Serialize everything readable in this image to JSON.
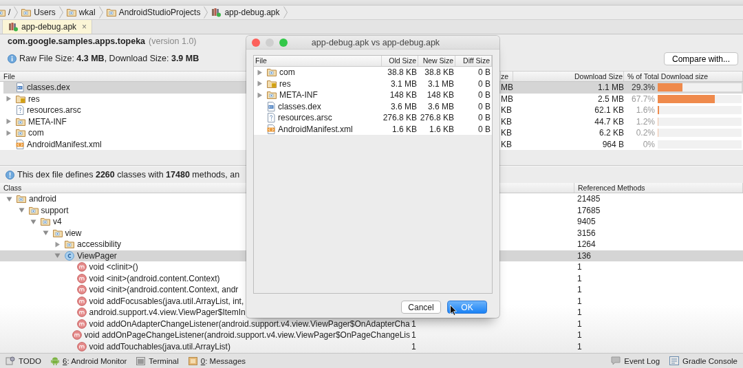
{
  "breadcrumb": [
    {
      "label": "/",
      "kind": "folder"
    },
    {
      "label": "Users",
      "kind": "folder"
    },
    {
      "label": "wkal",
      "kind": "folder"
    },
    {
      "label": "AndroidStudioProjects",
      "kind": "folder"
    },
    {
      "label": "app-debug.apk",
      "kind": "apk"
    }
  ],
  "tabs": [
    {
      "label": "app-debug.apk",
      "close": "×",
      "selected": true
    }
  ],
  "summary": {
    "package": "com.google.samples.apps.topeka",
    "version": "(version 1.0)",
    "sizes": "Raw File Size: **4.3 MB**, Download Size: **3.9 MB**",
    "compare_button": "Compare with..."
  },
  "file_table": {
    "columns": [
      "File",
      "ze",
      "Download Size",
      "% of Total Download size"
    ],
    "rows": [
      {
        "name": "classes.dex",
        "kind": "dex",
        "column_2": "MB",
        "download_size": "1.1 MB",
        "percent": "29.3%",
        "level": 0.293,
        "selected": true
      },
      {
        "name": "res",
        "kind": "res",
        "expanded": false,
        "column_2": "MB",
        "download_size": "2.5 MB",
        "percent": "67.7%",
        "level": 0.677,
        "selected": false
      },
      {
        "name": "resources.arsc",
        "kind": "arsc",
        "column_2": "KB",
        "download_size": "62.1 KB",
        "percent": "1.6%",
        "level": 0.016,
        "selected": false
      },
      {
        "name": "META-INF",
        "kind": "folder",
        "expanded": false,
        "column_2": "KB",
        "download_size": "44.7 KB",
        "percent": "1.2%",
        "level": 0.012,
        "selected": false
      },
      {
        "name": "com",
        "kind": "folder",
        "expanded": false,
        "column_2": "KB",
        "download_size": "6.2 KB",
        "percent": "0.2%",
        "level": 0.002,
        "selected": false
      },
      {
        "name": "AndroidManifest.xml",
        "kind": "xml",
        "column_2": "KB",
        "download_size": "964 B",
        "percent": "0%",
        "level": 0,
        "selected": false
      }
    ]
  },
  "dex_info": "This dex file defines **2260** classes with **17480** methods, an",
  "class_tree": {
    "columns": [
      "Class",
      "Referenced Methods"
    ],
    "nodes": [
      {
        "name": "android",
        "kind": "package",
        "refs": "21485",
        "expanded": true,
        "selected": false,
        "children": [
          {
            "name": "support",
            "kind": "package",
            "refs": "17685",
            "expanded": true,
            "selected": false,
            "children": [
              {
                "name": "v4",
                "kind": "package",
                "refs": "9405",
                "expanded": true,
                "selected": false,
                "children": [
                  {
                    "name": "view",
                    "kind": "package",
                    "refs": "3156",
                    "expanded": true,
                    "selected": false,
                    "children": [
                      {
                        "name": "accessibility",
                        "kind": "package",
                        "refs": "1264",
                        "expanded": false,
                        "selected": false
                      },
                      {
                        "name": "ViewPager",
                        "kind": "class",
                        "refs": "136",
                        "expanded": true,
                        "selected": true,
                        "children": [
                          {
                            "name": "void <clinit>()",
                            "kind": "method",
                            "refs": "1",
                            "selected": false
                          },
                          {
                            "name": "void <init>(android.content.Context)",
                            "kind": "method",
                            "refs": "1",
                            "selected": false
                          },
                          {
                            "name": "void <init>(android.content.Context, andr",
                            "kind": "method",
                            "refs": "1",
                            "selected": false
                          },
                          {
                            "name": "void addFocusables(java.util.ArrayList, int,",
                            "kind": "method",
                            "refs": "1",
                            "selected": false
                          },
                          {
                            "name": "android.support.v4.view.ViewPager$ItemIn",
                            "kind": "method",
                            "refs": "1",
                            "selected": false
                          },
                          {
                            "name": "void addOnAdapterChangeListener(android.support.v4.view.ViewPager$OnAdapterCha",
                            "kind": "method",
                            "column_2": "1",
                            "refs": "1",
                            "selected": false
                          },
                          {
                            "name": "void addOnPageChangeListener(android.support.v4.view.ViewPager$OnPageChangeLis",
                            "kind": "method",
                            "column_2": "1",
                            "refs": "1",
                            "selected": false
                          },
                          {
                            "name": "void addTouchables(java.util.ArrayList)",
                            "kind": "method",
                            "column_2": "1",
                            "refs": "1",
                            "selected": false
                          }
                        ]
                      }
                    ]
                  }
                ]
              }
            ]
          }
        ]
      }
    ]
  },
  "dialog": {
    "title": "app-debug.apk vs app-debug.apk",
    "columns": [
      "File",
      "Old Size",
      "New Size",
      "Diff Size"
    ],
    "rows": [
      {
        "name": "com",
        "kind": "folder",
        "expanded": false,
        "old_size": "38.8 KB",
        "new_size": "38.8 KB",
        "diff_size": "0 B"
      },
      {
        "name": "res",
        "kind": "res",
        "expanded": false,
        "old_size": "3.1 MB",
        "new_size": "3.1 MB",
        "diff_size": "0 B"
      },
      {
        "name": "META-INF",
        "kind": "folder",
        "expanded": false,
        "old_size": "148 KB",
        "new_size": "148 KB",
        "diff_size": "0 B"
      },
      {
        "name": "classes.dex",
        "kind": "dex",
        "old_size": "3.6 MB",
        "new_size": "3.6 MB",
        "diff_size": "0 B"
      },
      {
        "name": "resources.arsc",
        "kind": "arsc",
        "old_size": "276.8 KB",
        "new_size": "276.8 KB",
        "diff_size": "0 B"
      },
      {
        "name": "AndroidManifest.xml",
        "kind": "xml",
        "old_size": "1.6 KB",
        "new_size": "1.6 KB",
        "diff_size": "0 B"
      }
    ],
    "buttons": [
      {
        "label": "Cancel",
        "default": false
      },
      {
        "label": "OK",
        "default": true
      }
    ]
  },
  "status_bar": {
    "left": [
      {
        "kind": "todo",
        "label": "TODO"
      },
      {
        "kind": "android",
        "mnemonic": "6",
        "label": ": Android Monitor"
      },
      {
        "kind": "terminal",
        "label": "Terminal"
      },
      {
        "kind": "messages",
        "mnemonic": "0",
        "label": ": Messages"
      }
    ],
    "right": [
      {
        "kind": "event",
        "label": "Event Log"
      },
      {
        "kind": "gradle",
        "label": "Gradle Console"
      }
    ]
  }
}
